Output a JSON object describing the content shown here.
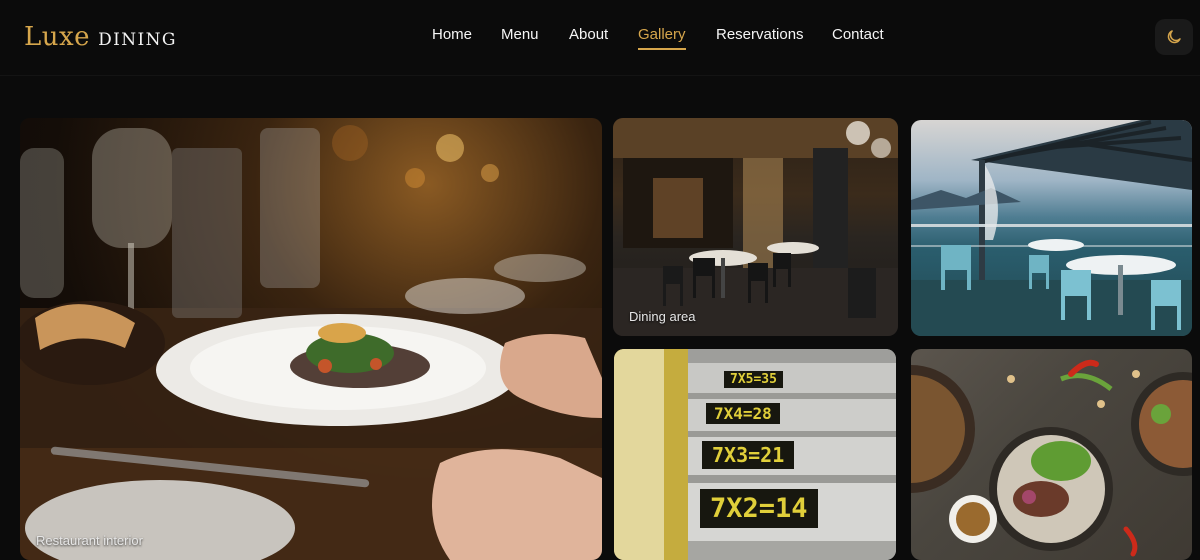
{
  "brand": {
    "name": "Luxe",
    "tagline": "DINING",
    "accent": "#d6a64c"
  },
  "nav": {
    "items": [
      {
        "label": "Home"
      },
      {
        "label": "Menu"
      },
      {
        "label": "About"
      },
      {
        "label": "Gallery",
        "active": true
      },
      {
        "label": "Reservations"
      },
      {
        "label": "Contact"
      }
    ]
  },
  "theme_toggle": {
    "icon": "moon-icon"
  },
  "gallery": {
    "items": [
      {
        "label": "Restaurant interior"
      },
      {
        "label": "Dining area"
      },
      {
        "label": ""
      },
      {
        "label": ""
      },
      {
        "label": ""
      }
    ],
    "stair_numbers": [
      "7X2=14",
      "7X3=21",
      "7X4=28",
      "7X5=35"
    ]
  },
  "colors": {
    "background": "#0b0b0b",
    "text": "#f5f5f5",
    "accent": "#d6a64c"
  }
}
